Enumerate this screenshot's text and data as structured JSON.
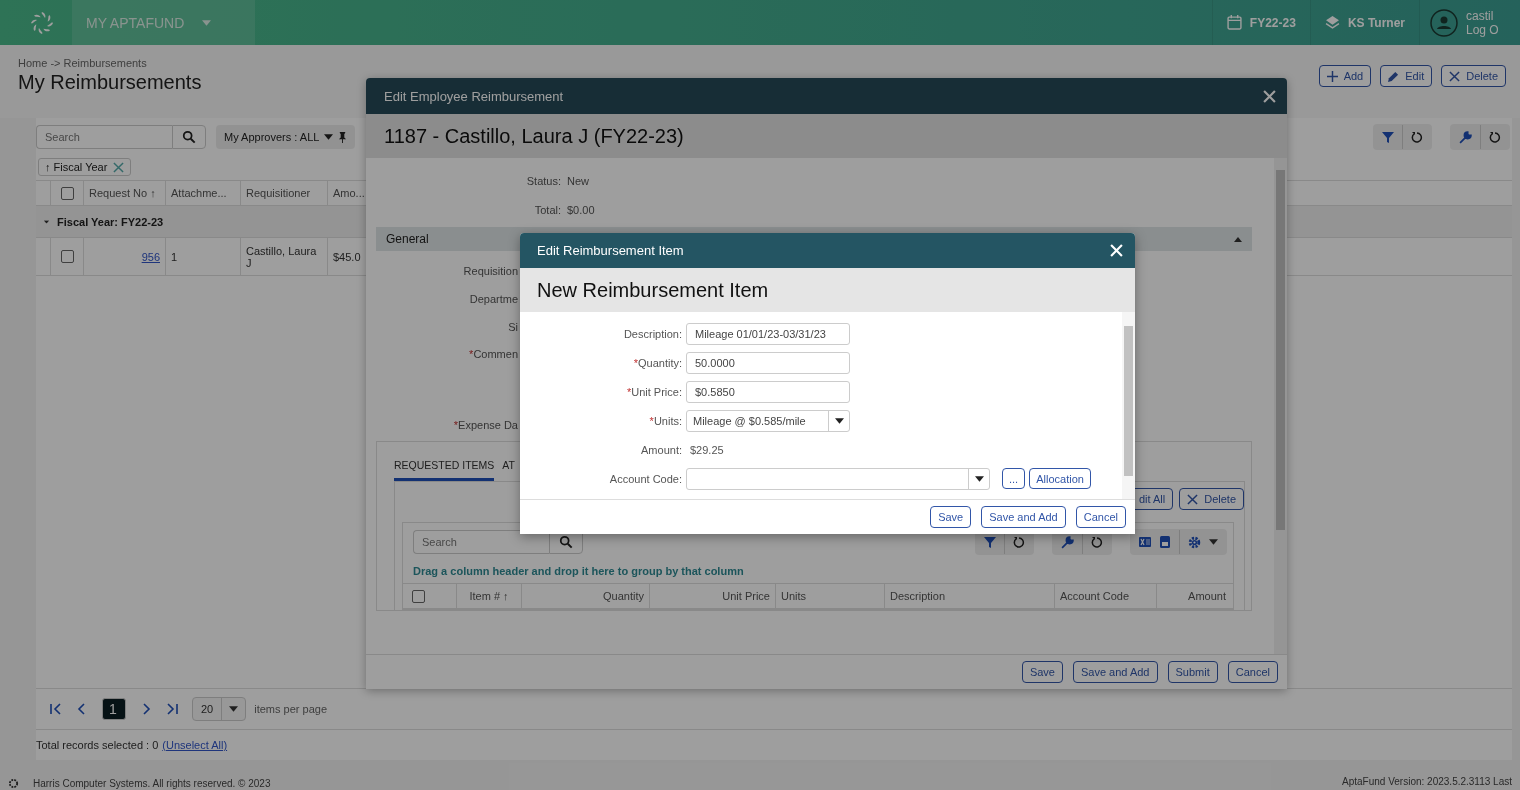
{
  "app_bar": {
    "title": "MY APTAFUND",
    "fiscal_year": "FY22-23",
    "organization": "KS Turner",
    "user": "castil",
    "logout": "Log O"
  },
  "page": {
    "breadcrumb": "Home -> Reimbursements",
    "title": "My Reimbursements",
    "actions": [
      {
        "kind": "add",
        "label": "Add"
      },
      {
        "kind": "edit",
        "label": "Edit"
      },
      {
        "kind": "delete",
        "label": "Delete"
      }
    ]
  },
  "grid": {
    "search_placeholder": "Search",
    "approvers_filter": "My Approvers : ALL",
    "group_chip": "↑ Fiscal Year",
    "select_all_checked": false,
    "columns": [
      "Request No ↑",
      "Attachme...",
      "Requisitioner",
      "Amo..."
    ],
    "group": {
      "label": "Fiscal Year: FY22-23",
      "expanded": true
    },
    "rows": [
      {
        "checked": false,
        "request_no": "956",
        "attachments": "1",
        "requisitioner": "Castillo, Laura J",
        "amount": "$45.0"
      }
    ],
    "pager": {
      "pages": [
        {
          "label": "1",
          "selected": true
        }
      ],
      "page_size": "20",
      "per_page_label": "items per page"
    },
    "selection_text": "Total records selected : 0",
    "unselect_link": "(Unselect All)"
  },
  "footer": {
    "copyright": "Harris Computer Systems. All rights reserved.  © 2023",
    "version": "AptaFund Version: 2023.5.2.3113  Last"
  },
  "reimbursement_dialog": {
    "title": "Edit Employee Reimbursement",
    "heading": "1187 - Castillo, Laura J (FY22-23)",
    "summary": [
      {
        "label": "Status:",
        "value": "New"
      },
      {
        "label": "Total:",
        "value": "$0.00"
      }
    ],
    "section": {
      "title": "General",
      "expanded": true
    },
    "fields": [
      {
        "label": "Requisition"
      },
      {
        "label": "Departme"
      },
      {
        "label": "Si"
      },
      {
        "label": "Commen",
        "marker": "*"
      },
      {
        "label": "Expense Da",
        "marker": "*"
      }
    ],
    "tabs": [
      {
        "label": "REQUESTED ITEMS",
        "selected": true
      },
      {
        "label": "AT",
        "selected": false
      }
    ],
    "item_actions": [
      "dit All",
      "Delete"
    ],
    "items_grid": {
      "search_placeholder": "Search",
      "group_hint": "Drag a column header and drop it here to group by that column",
      "select_all_checked": false,
      "columns": [
        "Item # ↑",
        "Quantity",
        "Unit Price",
        "Units",
        "Description",
        "Account Code",
        "Amount"
      ]
    },
    "buttons": [
      "Save",
      "Save and Add",
      "Submit",
      "Cancel"
    ]
  },
  "item_dialog": {
    "title": "Edit Reimbursement Item",
    "heading": "New Reimbursement Item",
    "fields": [
      {
        "kind": "text",
        "label": "Description:",
        "value": "Mileage 01/01/23-03/31/23"
      },
      {
        "kind": "text",
        "label": "Quantity:",
        "marker": "*",
        "value": "50.0000"
      },
      {
        "kind": "text",
        "label": "Unit Price:",
        "marker": "*",
        "value": "$0.5850"
      },
      {
        "kind": "select",
        "label": "Units:",
        "marker": "*",
        "value": "Mileage @ $0.585/mile"
      },
      {
        "kind": "readonly",
        "label": "Amount:",
        "value": "$29.25"
      },
      {
        "kind": "lookup",
        "label": "Account Code:",
        "buttons": [
          "...",
          "Allocation"
        ]
      }
    ],
    "buttons": [
      "Save",
      "Save and Add",
      "Cancel"
    ]
  }
}
